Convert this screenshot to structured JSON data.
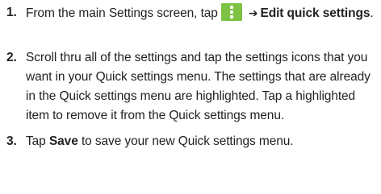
{
  "steps": [
    {
      "number": "1.",
      "text_before_icon": "From the main Settings screen, tap",
      "icon": "overflow-menu-icon",
      "icon_color": "#7dc243",
      "arrow": "➔",
      "bold_text": "Edit quick settings",
      "text_after": "."
    },
    {
      "number": "2.",
      "text": "Scroll thru all of the settings and tap the settings icons that you want in your Quick settings menu. The settings that are already in the Quick settings menu are highlighted. Tap a highlighted item to remove it from the Quick settings menu."
    },
    {
      "number": "3.",
      "text_before": "Tap",
      "bold_text": "Save",
      "text_after": "to save your new Quick settings menu."
    }
  ]
}
